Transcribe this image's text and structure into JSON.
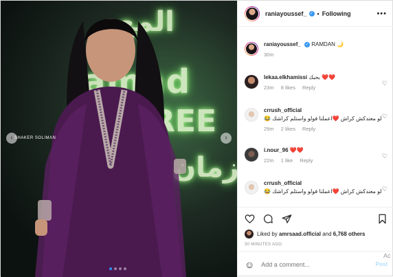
{
  "post": {
    "author": "raniayoussef_",
    "following_label": "Following",
    "dot": "•",
    "more_icon": "more-horizontal-icon",
    "photo_watermark": "SHAKER SOLIMAN",
    "carousel": {
      "slides": 4,
      "active": 1
    }
  },
  "caption": {
    "username": "raniayoussef_",
    "text": "RAMDAN 🌙",
    "time": "30m"
  },
  "comments": [
    {
      "username": "lekaa.elkhamissi",
      "text": "❤️❤️ بحبك",
      "time": "23m",
      "likes": "8 likes",
      "reply": "Reply"
    },
    {
      "username": "crrush_official",
      "text": "لو معندكش كراش ❤️اعملنا فولو واستلم كراشك 😂",
      "time": "29m",
      "likes": "2 likes",
      "reply": "Reply"
    },
    {
      "username": "i.nour_96",
      "text": "❤️❤️",
      "time": "22m",
      "likes": "1 like",
      "reply": "Reply"
    },
    {
      "username": "crrush_official",
      "text": "لو معندكش كراش ❤️اعملنا فولو واستلم كراشك 😂",
      "time": "",
      "likes": "",
      "reply": ""
    }
  ],
  "likes": {
    "prefix": "Liked by",
    "user": "amrsaad.official",
    "connector": "and",
    "count": "6,768 others"
  },
  "timestamp": "30 MINUTES AGO",
  "comment_box": {
    "placeholder": "Add a comment...",
    "post_label": "Post"
  },
  "overlay_text": "Ac",
  "colors": {
    "verified": "#3897f0",
    "heart_red": "#ed4956",
    "post_disabled": "#b2dffc",
    "carousel_active": "#2f8ff8"
  }
}
